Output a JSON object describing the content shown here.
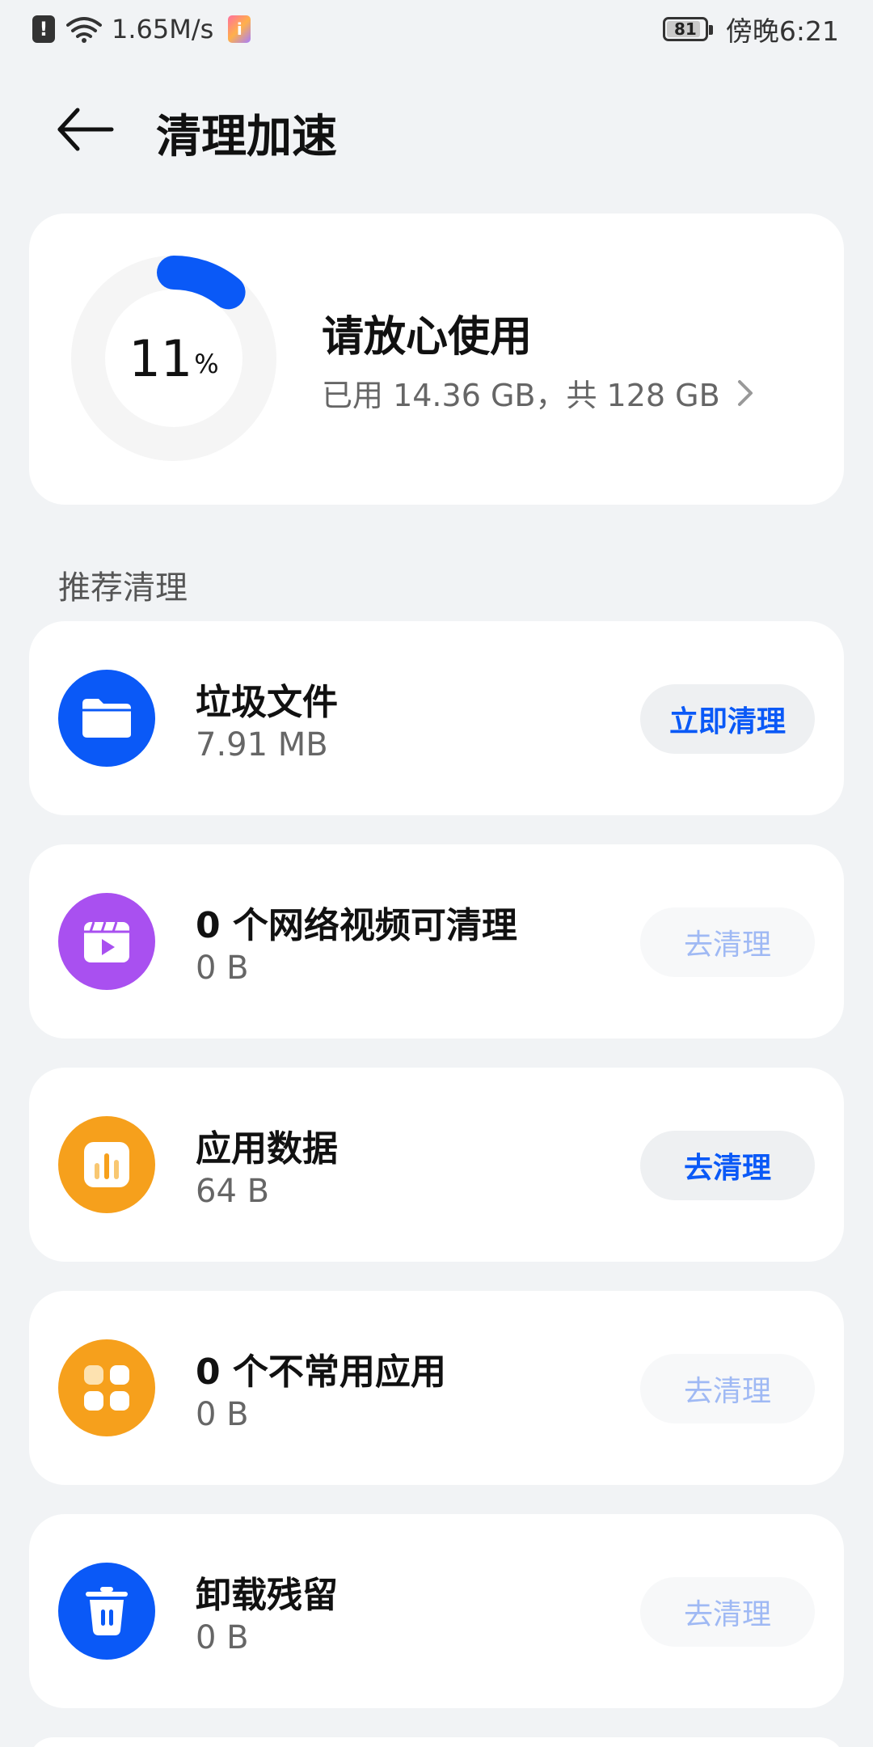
{
  "status_bar": {
    "alert_glyph": "!",
    "speed": "1.65M/s",
    "notif_glyph": "i",
    "battery": "81",
    "time": "傍晚6:21"
  },
  "header": {
    "title": "清理加速"
  },
  "storage": {
    "percent": "11",
    "percent_sign": "%",
    "used_fraction": 0.11,
    "status": "请放心使用",
    "detail": "已用 14.36 GB，共 128 GB",
    "ring_color": "#0a59f7"
  },
  "section": {
    "label": "推荐清理"
  },
  "items": [
    {
      "title": "垃圾文件",
      "size": "7.91 MB",
      "button": "立即清理",
      "enabled": true,
      "icon": "folder-icon",
      "color": "#0a59f7"
    },
    {
      "title": "0 个网络视频可清理",
      "size": "0 B",
      "button": "去清理",
      "enabled": false,
      "icon": "video-icon",
      "color": "#a950f0"
    },
    {
      "title": "应用数据",
      "size": "64 B",
      "button": "去清理",
      "enabled": true,
      "icon": "chart-icon",
      "color": "#f6a01c"
    },
    {
      "title": "0 个不常用应用",
      "size": "0 B",
      "button": "去清理",
      "enabled": false,
      "icon": "apps-grid-icon",
      "color": "#f6a01c"
    },
    {
      "title": "卸载残留",
      "size": "0 B",
      "button": "去清理",
      "enabled": false,
      "icon": "trash-icon",
      "color": "#0a59f7"
    }
  ]
}
